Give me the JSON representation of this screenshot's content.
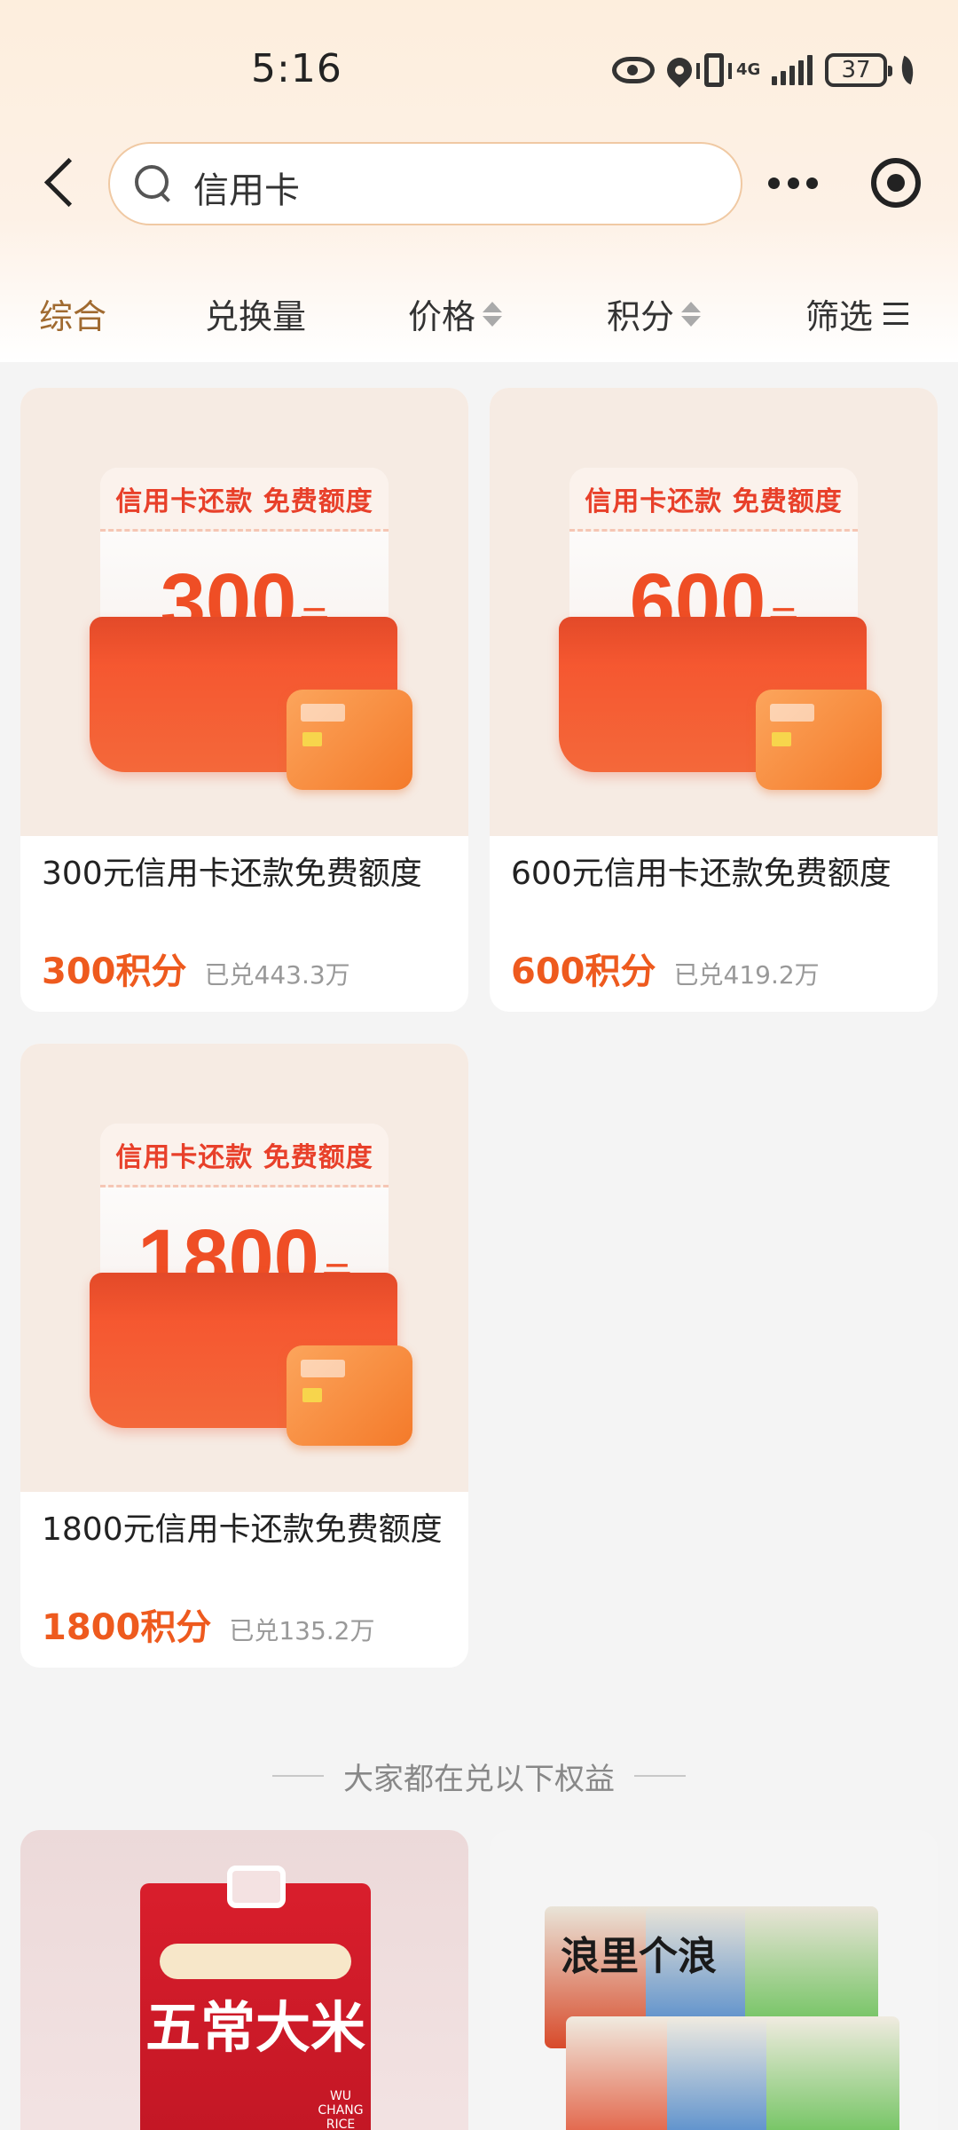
{
  "status_bar": {
    "time": "5:16",
    "network": "4G",
    "battery": "37",
    "icons": [
      "eye-icon",
      "location-icon",
      "vibrate-icon",
      "signal-icon",
      "battery-icon",
      "leaf-icon"
    ]
  },
  "header": {
    "search_value": "信用卡",
    "icons": [
      "back-icon",
      "search-icon",
      "more-icon",
      "target-icon"
    ]
  },
  "tabs": [
    {
      "label": "综合",
      "active": true
    },
    {
      "label": "兑换量"
    },
    {
      "label": "价格"
    },
    {
      "label": "积分"
    },
    {
      "label": "筛选"
    }
  ],
  "products": [
    {
      "coupon_title": "信用卡还款 免费额度",
      "amount": "300",
      "unit": "元",
      "title": "300元信用卡还款免费额度",
      "points": "300积分",
      "sold": "已兑443.3万"
    },
    {
      "coupon_title": "信用卡还款 免费额度",
      "amount": "600",
      "unit": "元",
      "title": "600元信用卡还款免费额度",
      "points": "600积分",
      "sold": "已兑419.2万"
    },
    {
      "coupon_title": "信用卡还款 免费额度",
      "amount": "1800",
      "unit": "元",
      "title": "1800元信用卡还款免费额度",
      "points": "1800积分",
      "sold": "已兑135.2万"
    }
  ],
  "section": {
    "title": "大家都在兑以下权益"
  },
  "recommendations": [
    {
      "title": "五常大米",
      "sub": "WU CHANG RICE"
    },
    {
      "title": "浪里个浪"
    }
  ],
  "colors": {
    "accent": "#ee5a1e",
    "active_tab": "#a06a30",
    "coupon_red": "#e8402a",
    "background": "#f4f4f4"
  }
}
